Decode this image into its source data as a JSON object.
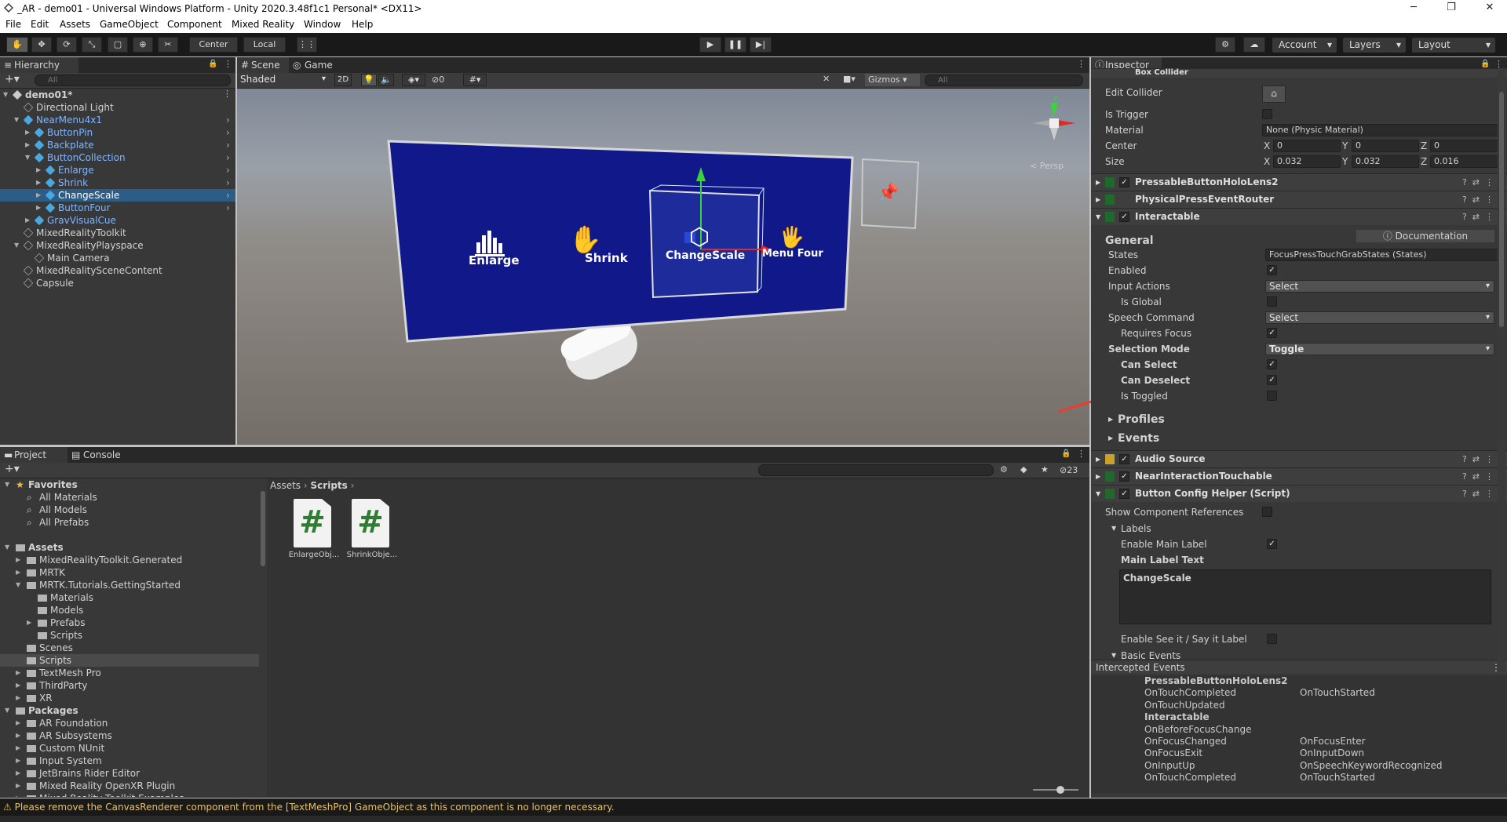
{
  "window": {
    "title": "_AR - demo01 - Universal Windows Platform - Unity 2020.3.48f1c1 Personal* <DX11>"
  },
  "menu": [
    "File",
    "Edit",
    "Assets",
    "GameObject",
    "Component",
    "Mixed Reality",
    "Window",
    "Help"
  ],
  "toolbar": {
    "center": "Center",
    "local": "Local",
    "account": "Account",
    "layers": "Layers",
    "layout": "Layout"
  },
  "hierarchy": {
    "tab": "Hierarchy",
    "search_placeholder": "All",
    "items": [
      {
        "label": "demo01*",
        "depth": 0,
        "arrow": "▼",
        "icon": "scene",
        "style": "scene"
      },
      {
        "label": "Directional Light",
        "depth": 1,
        "arrow": "",
        "icon": "go",
        "style": ""
      },
      {
        "label": "NearMenu4x1",
        "depth": 1,
        "arrow": "▼",
        "icon": "prefab",
        "style": "blue"
      },
      {
        "label": "ButtonPin",
        "depth": 2,
        "arrow": "▶",
        "icon": "prefab",
        "style": "blue"
      },
      {
        "label": "Backplate",
        "depth": 2,
        "arrow": "▶",
        "icon": "prefab",
        "style": "blue"
      },
      {
        "label": "ButtonCollection",
        "depth": 2,
        "arrow": "▼",
        "icon": "prefab",
        "style": "blue"
      },
      {
        "label": "Enlarge",
        "depth": 3,
        "arrow": "▶",
        "icon": "prefab",
        "style": "blue"
      },
      {
        "label": "Shrink",
        "depth": 3,
        "arrow": "▶",
        "icon": "prefab",
        "style": "blue"
      },
      {
        "label": "ChangeScale",
        "depth": 3,
        "arrow": "▶",
        "icon": "prefab",
        "style": "selected"
      },
      {
        "label": "ButtonFour",
        "depth": 3,
        "arrow": "▶",
        "icon": "prefab",
        "style": "blue"
      },
      {
        "label": "GravVisualCue",
        "depth": 2,
        "arrow": "▶",
        "icon": "prefab",
        "style": "blue"
      },
      {
        "label": "MixedRealityToolkit",
        "depth": 1,
        "arrow": "",
        "icon": "go",
        "style": ""
      },
      {
        "label": "MixedRealityPlayspace",
        "depth": 1,
        "arrow": "▼",
        "icon": "go",
        "style": ""
      },
      {
        "label": "Main Camera",
        "depth": 2,
        "arrow": "",
        "icon": "go",
        "style": ""
      },
      {
        "label": "MixedRealitySceneContent",
        "depth": 1,
        "arrow": "",
        "icon": "go",
        "style": ""
      },
      {
        "label": "Capsule",
        "depth": 1,
        "arrow": "",
        "icon": "go",
        "style": ""
      }
    ]
  },
  "scene": {
    "tabs": [
      "Scene",
      "Game"
    ],
    "shading": "Shaded",
    "mode2d": "2D",
    "fx_count": "0",
    "gizmos": "Gizmos",
    "search_placeholder": "All",
    "persp": "< Persp",
    "menu_buttons": [
      "Enlarge",
      "Shrink",
      "ChangeScale",
      "Menu Four"
    ]
  },
  "project": {
    "tabs": [
      "Project",
      "Console"
    ],
    "hidden_count": "23",
    "breadcrumb": [
      "Assets",
      "Scripts"
    ],
    "tree": [
      {
        "label": "Favorites",
        "depth": 0,
        "arrow": "▼",
        "icon": "star",
        "bold": true
      },
      {
        "label": "All Materials",
        "depth": 1,
        "arrow": "",
        "icon": "search",
        "bold": false
      },
      {
        "label": "All Models",
        "depth": 1,
        "arrow": "",
        "icon": "search",
        "bold": false
      },
      {
        "label": "All Prefabs",
        "depth": 1,
        "arrow": "",
        "icon": "search",
        "bold": false
      },
      {
        "label": "",
        "depth": 0,
        "arrow": "",
        "icon": "",
        "bold": false
      },
      {
        "label": "Assets",
        "depth": 0,
        "arrow": "▼",
        "icon": "folder",
        "bold": true
      },
      {
        "label": "MixedRealityToolkit.Generated",
        "depth": 1,
        "arrow": "▶",
        "icon": "folder",
        "bold": false
      },
      {
        "label": "MRTK",
        "depth": 1,
        "arrow": "▶",
        "icon": "folder",
        "bold": false
      },
      {
        "label": "MRTK.Tutorials.GettingStarted",
        "depth": 1,
        "arrow": "▼",
        "icon": "folder",
        "bold": false
      },
      {
        "label": "Materials",
        "depth": 2,
        "arrow": "",
        "icon": "folder",
        "bold": false
      },
      {
        "label": "Models",
        "depth": 2,
        "arrow": "",
        "icon": "folder",
        "bold": false
      },
      {
        "label": "Prefabs",
        "depth": 2,
        "arrow": "▶",
        "icon": "folder",
        "bold": false
      },
      {
        "label": "Scripts",
        "depth": 2,
        "arrow": "",
        "icon": "folder",
        "bold": false
      },
      {
        "label": "Scenes",
        "depth": 1,
        "arrow": "",
        "icon": "folder",
        "bold": false
      },
      {
        "label": "Scripts",
        "depth": 1,
        "arrow": "",
        "icon": "folder",
        "bold": false,
        "selected": true
      },
      {
        "label": "TextMesh Pro",
        "depth": 1,
        "arrow": "▶",
        "icon": "folder",
        "bold": false
      },
      {
        "label": "ThirdParty",
        "depth": 1,
        "arrow": "▶",
        "icon": "folder",
        "bold": false
      },
      {
        "label": "XR",
        "depth": 1,
        "arrow": "▶",
        "icon": "folder",
        "bold": false
      },
      {
        "label": "Packages",
        "depth": 0,
        "arrow": "▼",
        "icon": "folder",
        "bold": true
      },
      {
        "label": "AR Foundation",
        "depth": 1,
        "arrow": "▶",
        "icon": "folder",
        "bold": false
      },
      {
        "label": "AR Subsystems",
        "depth": 1,
        "arrow": "▶",
        "icon": "folder",
        "bold": false
      },
      {
        "label": "Custom NUnit",
        "depth": 1,
        "arrow": "▶",
        "icon": "folder",
        "bold": false
      },
      {
        "label": "Input System",
        "depth": 1,
        "arrow": "▶",
        "icon": "folder",
        "bold": false
      },
      {
        "label": "JetBrains Rider Editor",
        "depth": 1,
        "arrow": "▶",
        "icon": "folder",
        "bold": false
      },
      {
        "label": "Mixed Reality OpenXR Plugin",
        "depth": 1,
        "arrow": "▶",
        "icon": "folder",
        "bold": false
      },
      {
        "label": "Mixed Reality Toolkit Examples",
        "depth": 1,
        "arrow": "▶",
        "icon": "folder",
        "bold": false
      }
    ],
    "assets": [
      {
        "label": "EnlargeObj...",
        "glyph": "#"
      },
      {
        "label": "ShrinkObje...",
        "glyph": "#"
      }
    ]
  },
  "inspector": {
    "tab": "Inspector",
    "box_collider": {
      "name": "Box Collider",
      "edit_collider": "Edit Collider",
      "is_trigger": "Is Trigger",
      "material_label": "Material",
      "material_value": "None (Physic Material)",
      "center_label": "Center",
      "size_label": "Size",
      "center": {
        "x": "0",
        "y": "0",
        "z": "0"
      },
      "size": {
        "x": "0.032",
        "y": "0.032",
        "z": "0.016"
      },
      "axis": {
        "x": "X",
        "y": "Y",
        "z": "Z"
      }
    },
    "components": [
      "PressableButtonHoloLens2",
      "PhysicalPressEventRouter",
      "Interactable"
    ],
    "interactable": {
      "general": "General",
      "documentation": "Documentation",
      "states_label": "States",
      "states_value": "FocusPressTouchGrabStates (States)",
      "enabled": "Enabled",
      "input_actions": "Input Actions",
      "input_actions_value": "Select",
      "is_global": "Is Global",
      "speech_command": "Speech Command",
      "speech_value": "Select",
      "requires_focus": "Requires Focus",
      "selection_mode": "Selection Mode",
      "selection_value": "Toggle",
      "can_select": "Can Select",
      "can_deselect": "Can Deselect",
      "is_toggled": "Is Toggled",
      "profiles": "Profiles",
      "events": "Events"
    },
    "components2": [
      "Audio Source",
      "NearInteractionTouchable",
      "Button Config Helper (Script)"
    ],
    "bch": {
      "show_refs": "Show Component References",
      "labels": "Labels",
      "enable_main": "Enable Main Label",
      "main_text_label": "Main Label Text",
      "main_text": "ChangeScale",
      "enable_see": "Enable See it / Say it Label",
      "basic_events": "Basic Events"
    },
    "intercepted": {
      "title": "Intercepted Events",
      "left": [
        "PressableButtonHoloLens2",
        "OnTouchCompleted",
        "OnTouchUpdated",
        "Interactable",
        "OnBeforeFocusChange",
        "OnFocusChanged",
        "OnFocusExit",
        "OnInputUp",
        "OnTouchCompleted"
      ],
      "right": [
        "",
        "OnTouchStarted",
        "",
        "",
        "",
        "OnFocusEnter",
        "OnInputDown",
        "OnSpeechKeywordRecognized",
        "OnTouchStarted"
      ]
    }
  },
  "status": {
    "message": "Please remove the CanvasRenderer component from the [TextMeshPro] GameObject as this component is no longer necessary."
  },
  "colors": {
    "accent_selected": "#2c5d87",
    "panel": "#383838",
    "menu_panel": "#10188a",
    "annotation": "#f03a2a"
  }
}
